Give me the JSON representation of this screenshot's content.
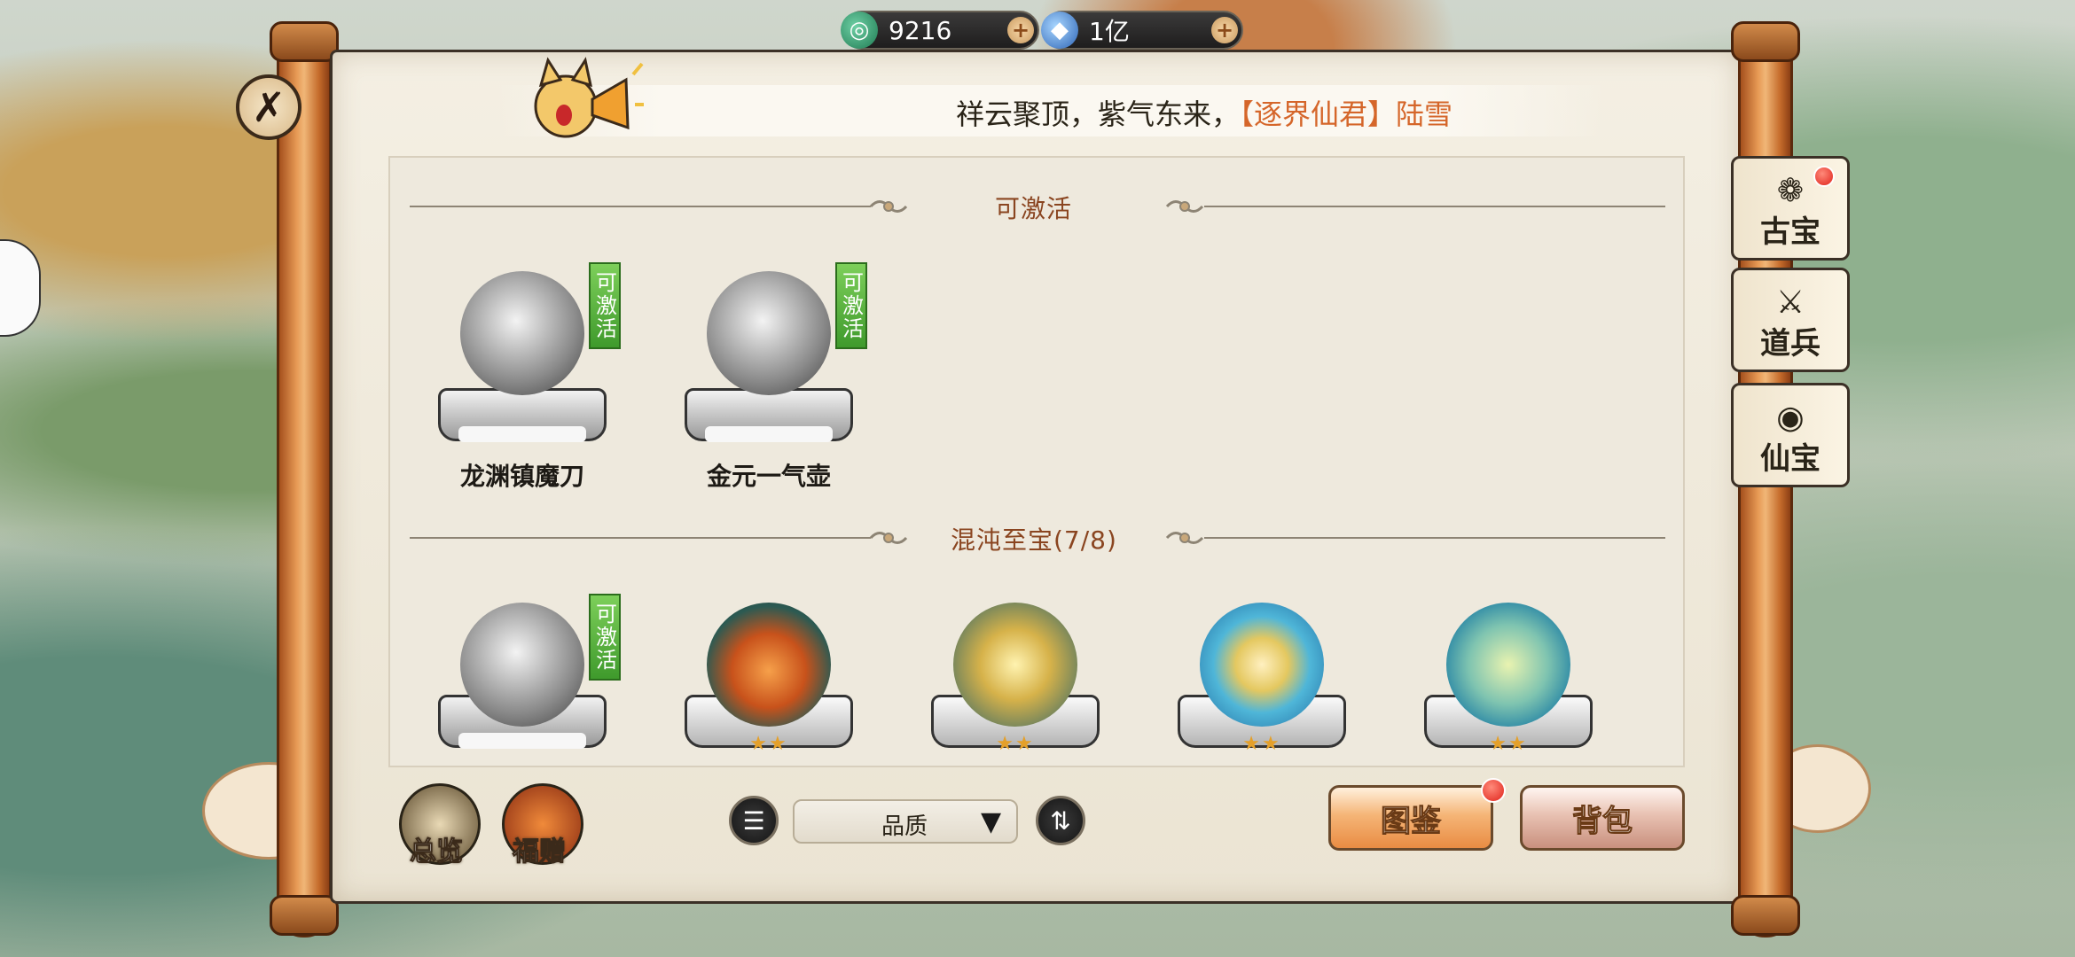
{
  "currency": {
    "jade": {
      "value": "9216",
      "icon": "jade-swirl-icon"
    },
    "crystal": {
      "value": "1亿",
      "icon": "blue-crystal-icon"
    },
    "plus": "+"
  },
  "marquee": {
    "text_prefix": "祥云聚顶，紫气东来，",
    "text_highlight": "【逐界仙君】陆雪"
  },
  "sections": {
    "activatable": {
      "title": "可激活"
    },
    "chaos": {
      "title": "混沌至宝(7/8)"
    }
  },
  "tag_activate": "可激活",
  "activatable_items": [
    {
      "name": "龙渊镇魔刀",
      "style": "gray",
      "can_activate": true
    },
    {
      "name": "金元一气壶",
      "style": "gray",
      "can_activate": true
    }
  ],
  "chaos_items": [
    {
      "style": "gray",
      "can_activate": true,
      "stars": ""
    },
    {
      "style": "fire",
      "can_activate": false,
      "stars": "★★"
    },
    {
      "style": "gold",
      "can_activate": false,
      "stars": "★★"
    },
    {
      "style": "water",
      "can_activate": false,
      "stars": "★★"
    },
    {
      "style": "tree",
      "can_activate": false,
      "stars": "★★"
    }
  ],
  "side_tabs": [
    {
      "label": "古宝",
      "icon": "antique-icon",
      "glyph": "❁",
      "has_dot": true
    },
    {
      "label": "道兵",
      "icon": "weapon-icon",
      "glyph": "⚔",
      "has_dot": false
    },
    {
      "label": "仙宝",
      "icon": "fairy-treasure-icon",
      "glyph": "◉",
      "has_dot": false
    }
  ],
  "bottom": {
    "overview_label": "总览",
    "gift_label": "福赠",
    "filter_icon": "list-filter-icon",
    "sort_value": "品质",
    "sort_arrow": "▼",
    "swap_icon": "swap-order-icon",
    "swap_glyph": "⇅",
    "filter_glyph": "☰",
    "codex_label": "图鉴",
    "bag_label": "背包"
  },
  "close_glyph": "✗",
  "colors": {
    "accent": "#d5662a",
    "section_title": "#8a4520",
    "activate_tag": "#5cb33f",
    "red_dot": "#e0231b"
  }
}
